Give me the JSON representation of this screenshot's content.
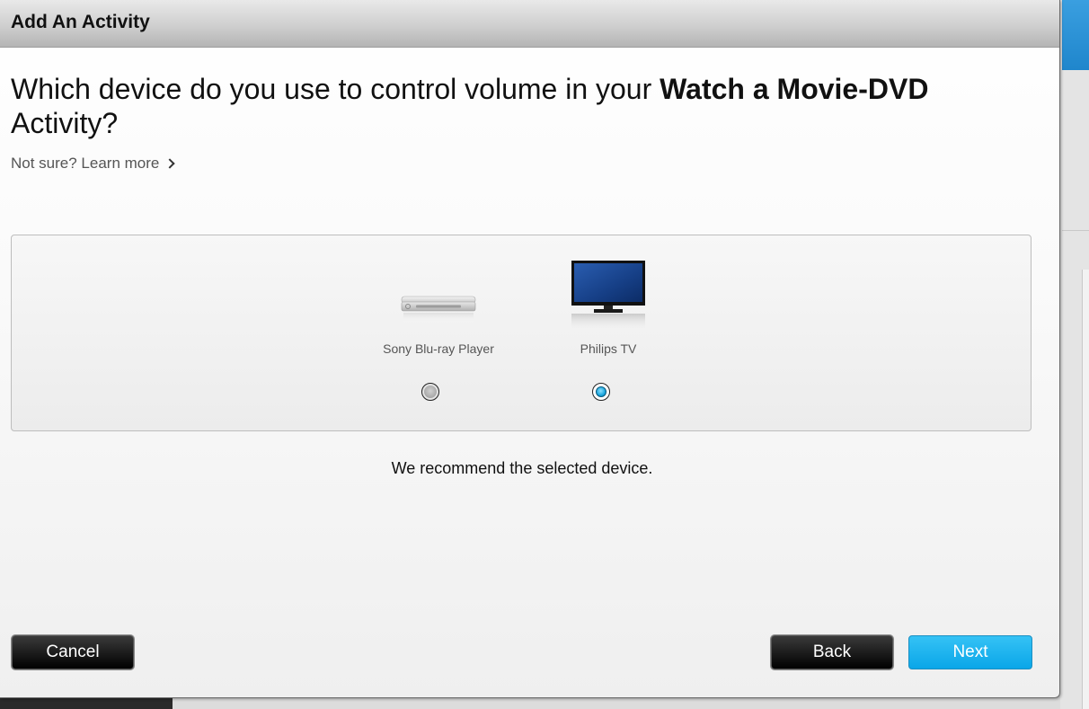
{
  "dialog": {
    "title": "Add An Activity",
    "question_prefix": "Which device do you use to control volume in your ",
    "question_bold": "Watch a Movie-DVD",
    "question_suffix": "Activity?",
    "learn_more": "Not sure? Learn more"
  },
  "devices": [
    {
      "name": "Sony Blu-ray Player",
      "icon": "blu-ray-player-icon",
      "selected": false
    },
    {
      "name": "Philips TV",
      "icon": "tv-icon",
      "selected": true
    }
  ],
  "recommendation": "We recommend the selected device.",
  "buttons": {
    "cancel": "Cancel",
    "back": "Back",
    "next": "Next"
  },
  "colors": {
    "accent": "#0aa6e8",
    "dark_button": "#000000"
  }
}
